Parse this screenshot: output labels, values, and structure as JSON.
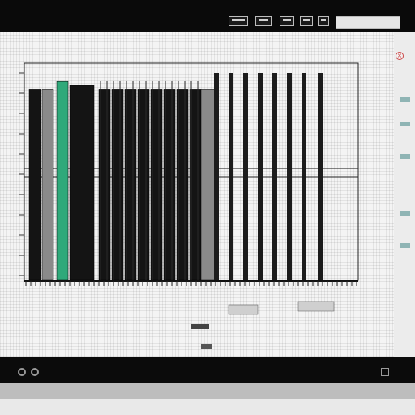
{
  "window": {
    "title": "",
    "search_placeholder": ""
  },
  "toolbar": {
    "buttons": [
      {
        "name": "toolbar-button-1"
      },
      {
        "name": "toolbar-button-2"
      },
      {
        "name": "toolbar-button-3"
      },
      {
        "name": "toolbar-button-4"
      },
      {
        "name": "toolbar-button-5"
      }
    ]
  },
  "canvas": {
    "labels": [
      "",
      "",
      "",
      "",
      ""
    ]
  },
  "chart_data": {
    "type": "bar",
    "note_visible": false,
    "categories": [
      "",
      "",
      "",
      "",
      "",
      "",
      "",
      "",
      "",
      "",
      "",
      "",
      "",
      "",
      "",
      "",
      "",
      "",
      "",
      "",
      ""
    ],
    "series": [
      {
        "name": "",
        "values": [
          0.92,
          0.92,
          0.96,
          0.94,
          0.92,
          0.92,
          0.92,
          0.92,
          0.92,
          0.92,
          0.92,
          0.92,
          0.92,
          1.0,
          1.0,
          1.0,
          1.0,
          1.0,
          1.0,
          1.0,
          1.0
        ]
      }
    ],
    "colors": {
      "dark": "#141414",
      "accent": "#2fa97a",
      "mid": "#8a8a8a",
      "grid": "#222222"
    },
    "grid": true,
    "legend": "none"
  },
  "status": {
    "text": ""
  }
}
